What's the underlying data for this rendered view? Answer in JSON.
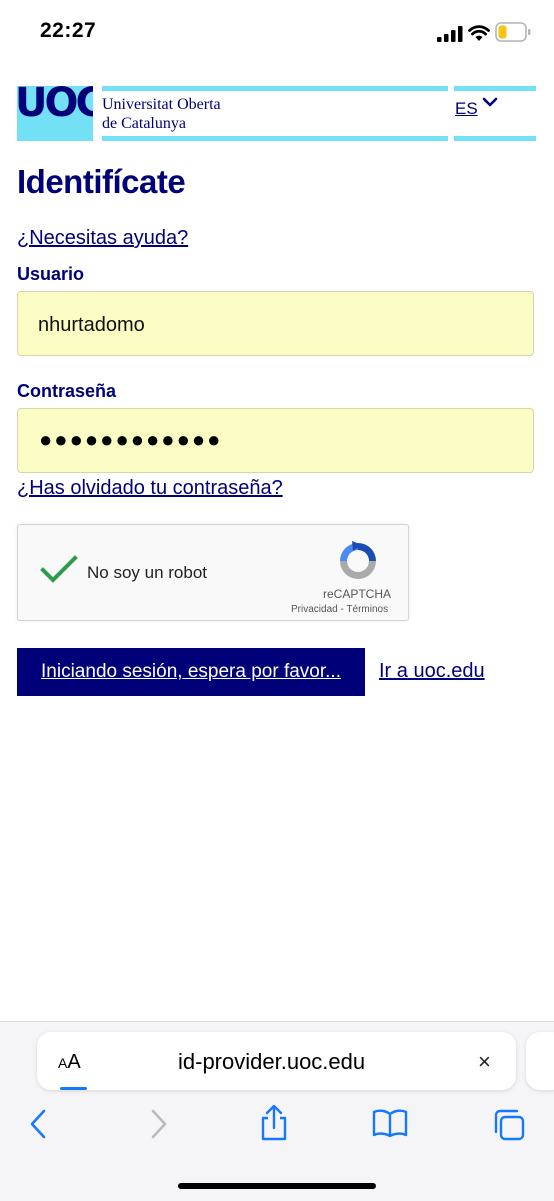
{
  "status_bar": {
    "time": "22:27"
  },
  "header": {
    "logo_text": "UOC",
    "university_line1": "Universitat Oberta",
    "university_line2": "de Catalunya",
    "language": "ES",
    "accent_color": "#73e0f5",
    "brand_color": "#000078"
  },
  "form": {
    "title": "Identifícate",
    "help_link": "¿Necesitas ayuda?",
    "user_label": "Usuario",
    "user_value": "nhurtadomo",
    "password_label": "Contraseña",
    "password_value": "●●●●●●●●●●●●",
    "forgot_link": "¿Has olvidado tu contraseña?",
    "field_color": "#fafcc4"
  },
  "captcha": {
    "label": "No soy un robot",
    "brand": "reCAPTCHA",
    "privacy": "Privacidad",
    "separator": " - ",
    "terms": "Términos",
    "checked": true
  },
  "actions": {
    "signin_button": "Iniciando sesión, espera por favor...",
    "uoc_link": "Ir a uoc.edu"
  },
  "browser": {
    "aa_small": "A",
    "aa_large": "A",
    "url": "id-provider.uoc.edu",
    "close_glyph": "×",
    "toolbar_icons": [
      "back-icon",
      "forward-icon",
      "share-icon",
      "bookmarks-icon",
      "tabs-icon"
    ]
  }
}
